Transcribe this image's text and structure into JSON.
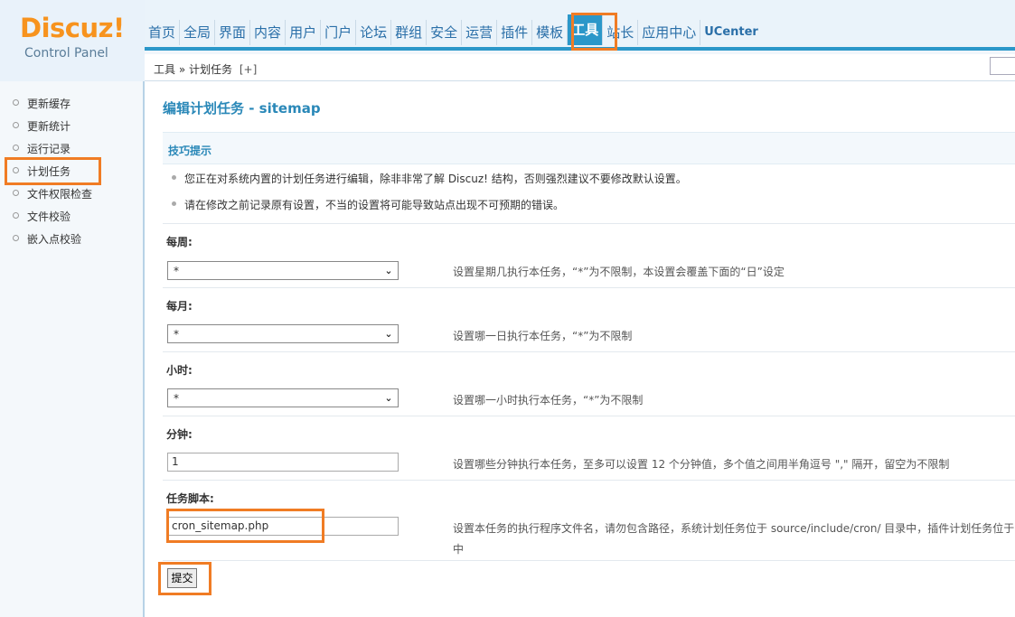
{
  "logo": {
    "brand": "Discuz!",
    "subtitle": "Control Panel"
  },
  "topnav": {
    "items": [
      "首页",
      "全局",
      "界面",
      "内容",
      "用户",
      "门户",
      "论坛",
      "群组",
      "安全",
      "运营",
      "插件",
      "模板",
      "工具",
      "站长",
      "应用中心",
      "UCenter"
    ],
    "active": "工具"
  },
  "breadcrumb": {
    "root": "工具",
    "sep": "»",
    "current": "计划任务",
    "add": "[+]"
  },
  "sidebar": {
    "items": [
      {
        "label": "更新缓存"
      },
      {
        "label": "更新统计"
      },
      {
        "label": "运行记录"
      },
      {
        "label": "计划任务"
      },
      {
        "label": "文件权限检查"
      },
      {
        "label": "文件校验"
      },
      {
        "label": "嵌入点校验"
      }
    ],
    "active": "计划任务"
  },
  "main": {
    "title": "编辑计划任务 - sitemap",
    "tips_title": "技巧提示",
    "tips": [
      "您正在对系统内置的计划任务进行编辑，除非非常了解 Discuz! 结构，否则强烈建议不要修改默认设置。",
      "请在修改之前记录原有设置，不当的设置将可能导致站点出现不可预期的错误。"
    ],
    "fields": {
      "weekday": {
        "label": "每周:",
        "value": "*",
        "desc": "设置星期几执行本任务，“*”为不限制，本设置会覆盖下面的“日”设定"
      },
      "day": {
        "label": "每月:",
        "value": "*",
        "desc": "设置哪一日执行本任务，“*”为不限制"
      },
      "hour": {
        "label": "小时:",
        "value": "*",
        "desc": "设置哪一小时执行本任务，“*”为不限制"
      },
      "minute": {
        "label": "分钟:",
        "value": "1",
        "desc": "设置哪些分钟执行本任务，至多可以设置 12 个分钟值，多个值之间用半角逗号 \",\" 隔开，留空为不限制"
      },
      "script": {
        "label": "任务脚本:",
        "value": "cron_sitemap.php",
        "desc": "设置本任务的执行程序文件名，请勿包含路径，系统计划任务位于 source/include/cron/ 目录中，插件计划任务位于",
        "desc2": "中"
      }
    },
    "submit_label": "提交"
  },
  "colors": {
    "accent": "#2b97c9",
    "highlight": "#f07c24",
    "title": "#2a88b8"
  }
}
